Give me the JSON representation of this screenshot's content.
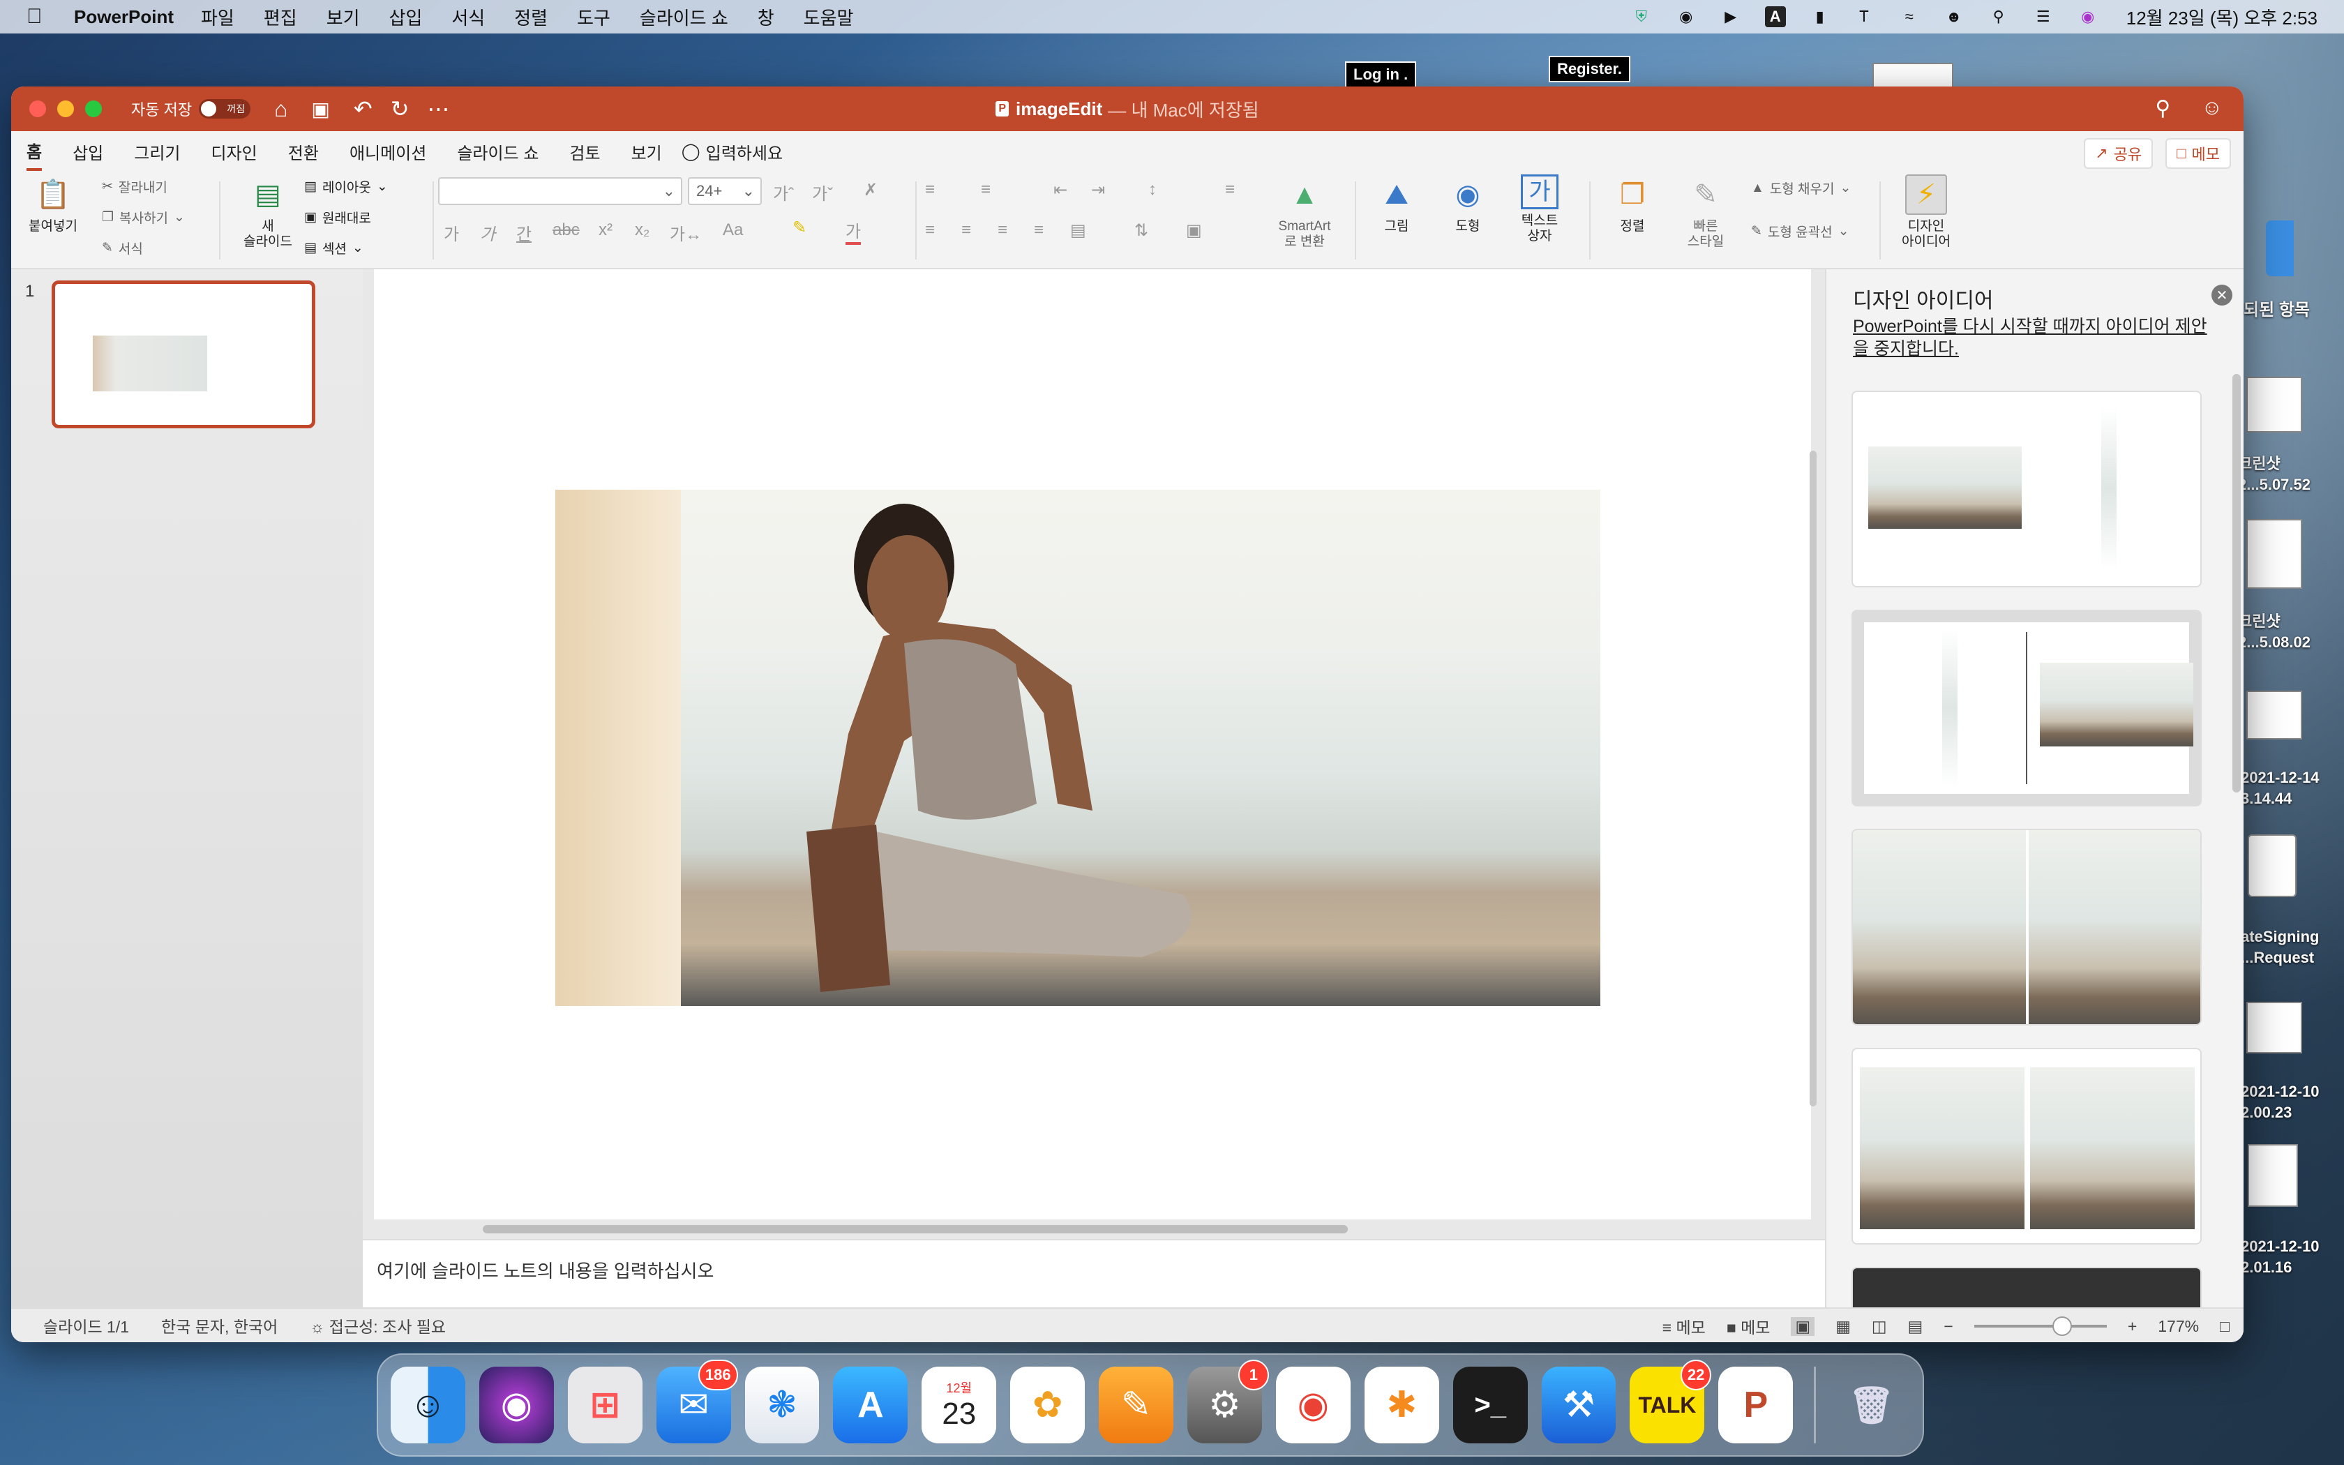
{
  "menubar": {
    "app_name": "PowerPoint",
    "items": [
      "파일",
      "편집",
      "보기",
      "삽입",
      "서식",
      "정렬",
      "도구",
      "슬라이드 쇼",
      "창",
      "도움말"
    ],
    "clock": "12월 23일 (목) 오후 2:53"
  },
  "desktop": {
    "login_label": "Log in .",
    "register_label": "Register.",
    "items": [
      "되된 항목",
      "크린샷 2...5.07.52",
      "크린샷 2...5.08.02",
      "2021-12-14 3.14.44",
      "ateSigning ...Request",
      "2021-12-10 2.00.23",
      "2021-12-10 2.01.16"
    ]
  },
  "window": {
    "autosave_label": "자동 저장",
    "autosave_state": "꺼짐",
    "doc_name": "imageEdit",
    "doc_location": "— 내 Mac에 저장됨",
    "tabs": [
      "홈",
      "삽입",
      "그리기",
      "디자인",
      "전환",
      "애니메이션",
      "슬라이드 쇼",
      "검토",
      "보기"
    ],
    "tell_me": "입력하세요",
    "share_label": "공유",
    "comment_label": "메모"
  },
  "ribbon": {
    "paste": "붙여넣기",
    "cut": "잘라내기",
    "copy": "복사하기",
    "format": "서식",
    "new_slide": "새\n슬라이드",
    "layout": "레이아웃",
    "reset": "원래대로",
    "section": "섹션",
    "font_size": "24+",
    "smartart": "SmartArt\n로 변환",
    "picture": "그림",
    "shapes": "도형",
    "textbox": "텍스트\n상자",
    "arrange": "정렬",
    "quick_styles": "빠른\n스타일",
    "shape_fill": "도형 채우기",
    "shape_outline": "도형 윤곽선",
    "design_ideas": "디자인\n아이디어"
  },
  "slides_panel": {
    "slide_number": "1"
  },
  "notes_placeholder": "여기에 슬라이드 노트의 내용을 입력하십시오",
  "design_pane": {
    "title": "디자인 아이디어",
    "stop_link": "PowerPoint를 다시 시작할 때까지 아이디어 제안을 중지합니다."
  },
  "statusbar": {
    "slide": "슬라이드 1/1",
    "language": "한국 문자, 한국어",
    "accessibility": "접근성: 조사 필요",
    "notes": "메모",
    "comments": "메모",
    "zoom": "177%"
  },
  "dock": {
    "apps": [
      "Finder",
      "Siri",
      "Launchpad",
      "Mail",
      "Safari",
      "App Store",
      "Calendar",
      "Photos",
      "Pages",
      "System Preferences",
      "Chrome",
      "Sketch",
      "Terminal",
      "Xcode",
      "KakaoTalk",
      "PowerPoint",
      "Trash"
    ],
    "mail_badge": "186",
    "prefs_badge": "1",
    "kakao_badge": "22",
    "calendar_month": "12월",
    "calendar_day": "23",
    "kakao_label": "TALK"
  }
}
